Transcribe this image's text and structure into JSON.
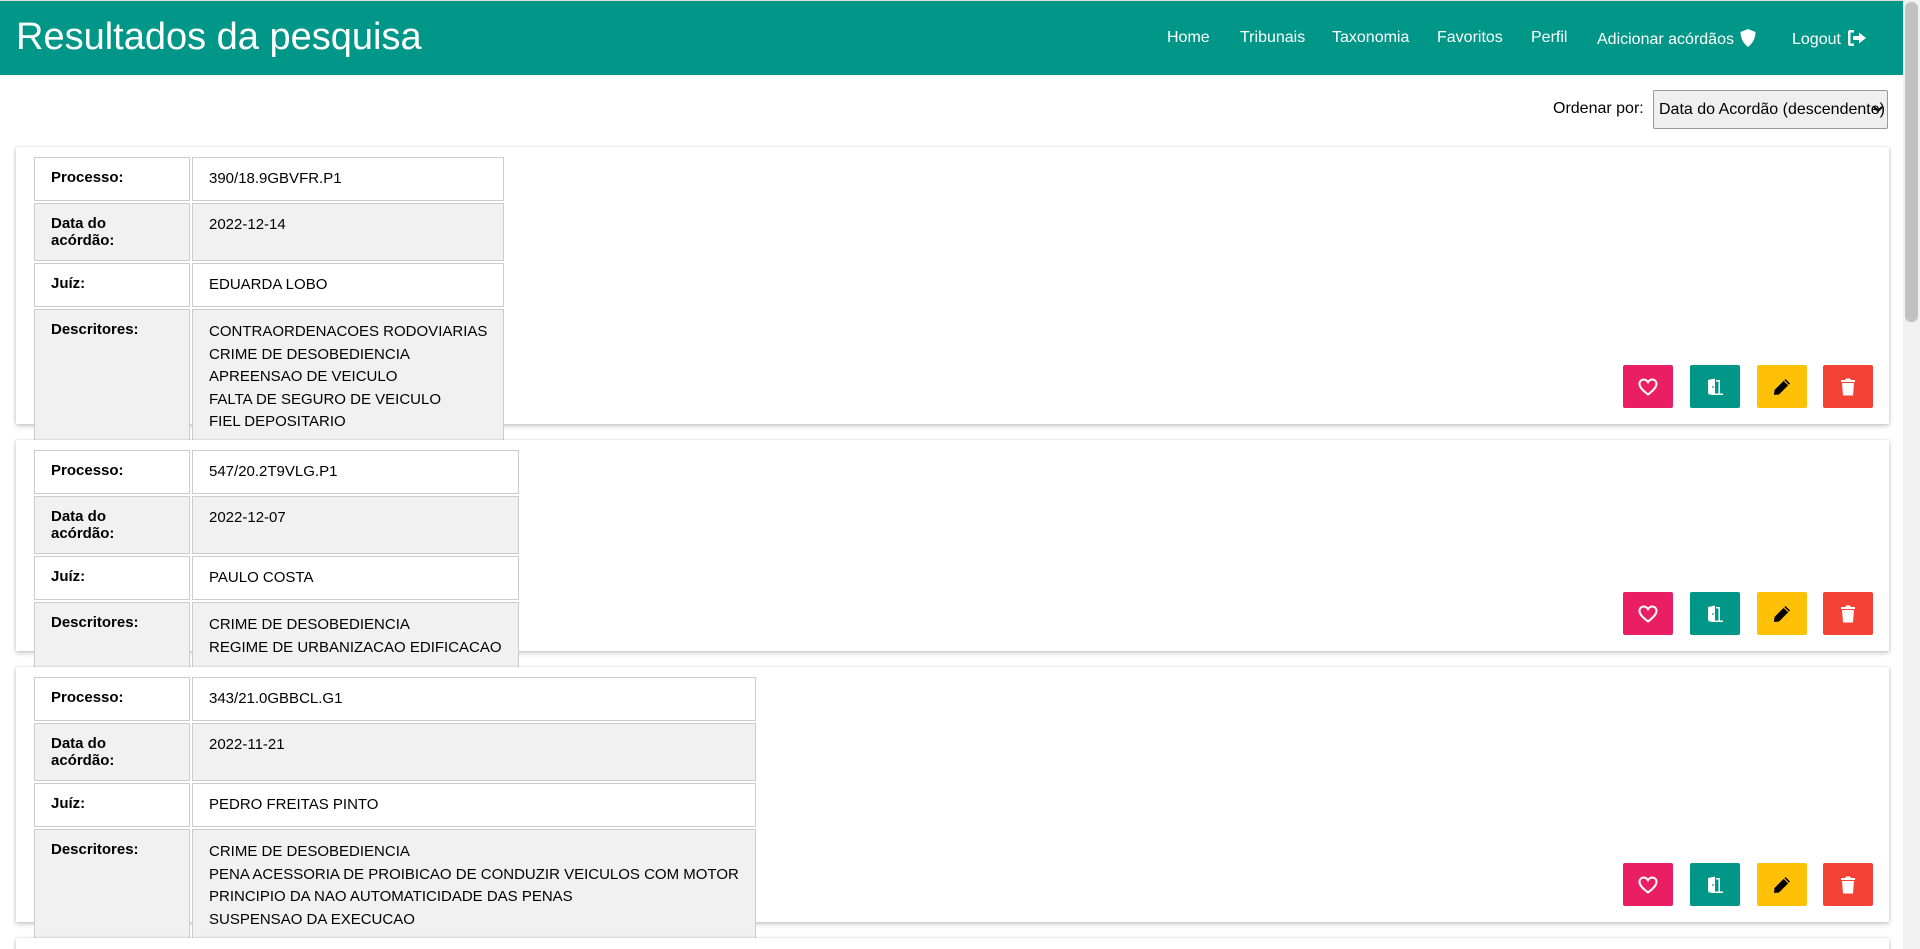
{
  "header": {
    "title": "Resultados da pesquisa",
    "nav": [
      {
        "label": "Home"
      },
      {
        "label": "Tribunais"
      },
      {
        "label": "Taxonomia"
      },
      {
        "label": "Favoritos"
      },
      {
        "label": "Perfil"
      },
      {
        "label": "Adicionar acórdãos",
        "icon": "shield-icon"
      },
      {
        "label": "Logout",
        "icon": "sign-out-icon"
      }
    ]
  },
  "sort": {
    "label": "Ordenar por:",
    "selected": "Data do Acordão (descendente)"
  },
  "field_labels": {
    "processo": "Processo:",
    "data": "Data do acórdão:",
    "juiz": "Juíz:",
    "descritores": "Descritores:"
  },
  "results": [
    {
      "processo": "390/18.9GBVFR.P1",
      "data": "2022-12-14",
      "juiz": "EDUARDA LOBO",
      "descritores": [
        "CONTRAORDENACOES RODOVIARIAS",
        "CRIME DE DESOBEDIENCIA",
        "APREENSAO DE VEICULO",
        "FALTA DE SEGURO DE VEICULO",
        "FIEL DEPOSITARIO"
      ]
    },
    {
      "processo": "547/20.2T9VLG.P1",
      "data": "2022-12-07",
      "juiz": "PAULO COSTA",
      "descritores": [
        "CRIME DE DESOBEDIENCIA",
        "REGIME DE URBANIZACAO EDIFICACAO"
      ]
    },
    {
      "processo": "343/21.0GBBCL.G1",
      "data": "2022-11-21",
      "juiz": "PEDRO FREITAS PINTO",
      "descritores": [
        "CRIME DE DESOBEDIENCIA",
        "PENA ACESSORIA DE PROIBICAO DE CONDUZIR VEICULOS COM MOTOR",
        "PRINCIPIO DA NAO AUTOMATICIDADE DAS PENAS",
        "SUSPENSAO DA EXECUCAO"
      ]
    }
  ],
  "actions": [
    {
      "name": "favorite-button",
      "icon": "heart-icon",
      "color": "#e91e63"
    },
    {
      "name": "open-button",
      "icon": "door-open-icon",
      "color": "#009688"
    },
    {
      "name": "edit-button",
      "icon": "pencil-icon",
      "color": "#ffc107"
    },
    {
      "name": "delete-button",
      "icon": "trash-icon",
      "color": "#f44336"
    }
  ],
  "colors": {
    "primary": "#009688",
    "favorite": "#e91e63",
    "edit": "#ffc107",
    "delete": "#f44336"
  }
}
